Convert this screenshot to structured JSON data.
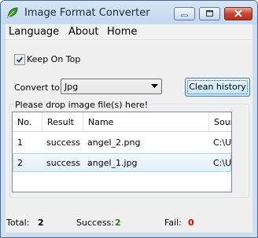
{
  "window": {
    "title": "Image Format Converter",
    "icon": "leaf-icon"
  },
  "menu": {
    "items": [
      {
        "label": "Language"
      },
      {
        "label": "About"
      },
      {
        "label": "Home"
      }
    ]
  },
  "options": {
    "keep_on_top_label": "Keep On Top",
    "keep_on_top_checked": true
  },
  "convert": {
    "label": "Convert to:",
    "selected": "Jpg"
  },
  "clean_history_label": "Clean history",
  "drop_prompt": "Please drop image file(s) here!",
  "table": {
    "columns": [
      "No.",
      "Result",
      "Name",
      "Sourc"
    ],
    "rows": [
      [
        "1",
        "success",
        "angel_2.png",
        "C:\\Us"
      ],
      [
        "2",
        "success",
        "angel_1.jpg",
        "C:\\Us"
      ]
    ],
    "selected_row": 2
  },
  "status": {
    "total_label": "Total:",
    "total_value": "2",
    "success_label": "Success:",
    "success_value": "2",
    "fail_label": "Fail:",
    "fail_value": "0",
    "success_color": "#1a8a1a",
    "fail_color": "#e00000"
  }
}
